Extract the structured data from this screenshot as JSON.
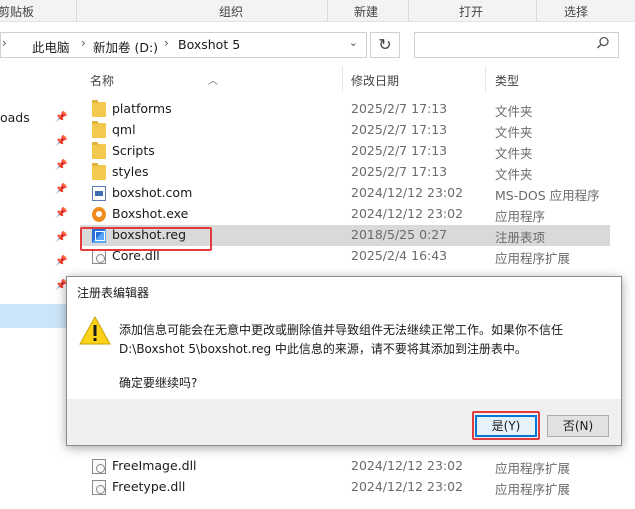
{
  "ribbon": {
    "groups": [
      "剪贴板",
      "组织",
      "新建",
      "打开",
      "选择"
    ]
  },
  "address": {
    "crumbs": [
      "此电脑",
      "新加卷 (D:)",
      "Boxshot 5"
    ]
  },
  "search": {
    "placeholder": ""
  },
  "nav": {
    "partial_label": "oads"
  },
  "columns": {
    "name": "名称",
    "date": "修改日期",
    "type": "类型"
  },
  "files": [
    {
      "name": "platforms",
      "date": "2025/2/7 17:13",
      "type": "文件夹",
      "icon": "folder-icon"
    },
    {
      "name": "qml",
      "date": "2025/2/7 17:13",
      "type": "文件夹",
      "icon": "folder-icon"
    },
    {
      "name": "Scripts",
      "date": "2025/2/7 17:13",
      "type": "文件夹",
      "icon": "folder-icon"
    },
    {
      "name": "styles",
      "date": "2025/2/7 17:13",
      "type": "文件夹",
      "icon": "folder-icon"
    },
    {
      "name": "boxshot.com",
      "date": "2024/12/12 23:02",
      "type": "MS-DOS 应用程序",
      "icon": "msdos-app-icon"
    },
    {
      "name": "Boxshot.exe",
      "date": "2024/12/12 23:02",
      "type": "应用程序",
      "icon": "boxshot-app-icon"
    },
    {
      "name": "boxshot.reg",
      "date": "2018/5/25 0:27",
      "type": "注册表项",
      "icon": "registry-file-icon"
    },
    {
      "name": "Core.dll",
      "date": "2025/2/4 16:43",
      "type": "应用程序扩展",
      "icon": "dll-file-icon"
    }
  ],
  "files_below": [
    {
      "name": "FreeImage.dll",
      "date": "2024/12/12 23:02",
      "type": "应用程序扩展",
      "icon": "dll-file-icon"
    },
    {
      "name": "Freetype.dll",
      "date": "2024/12/12 23:02",
      "type": "应用程序扩展",
      "icon": "dll-file-icon"
    }
  ],
  "dialog": {
    "title": "注册表编辑器",
    "message_line1": "添加信息可能会在无意中更改或删除值并导致组件无法继续正常工作。如果你不信任",
    "message_line2": "D:\\Boxshot 5\\boxshot.reg 中此信息的来源，请不要将其添加到注册表中。",
    "confirm": "确定要继续吗?",
    "yes_label": "是(Y)",
    "no_label": "否(N)"
  },
  "colors": {
    "highlight": "#e23b3b",
    "accent": "#0078d7",
    "selection": "#d9d9d9"
  }
}
